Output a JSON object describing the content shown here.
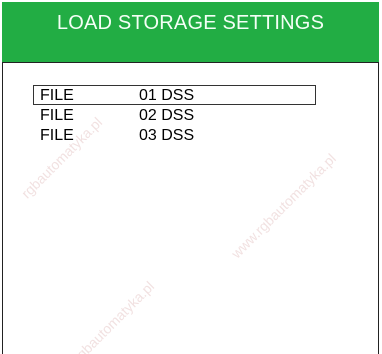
{
  "header": {
    "title": "LOAD STORAGE SETTINGS"
  },
  "files": [
    {
      "label": "FILE",
      "name": "01 DSS",
      "selected": true
    },
    {
      "label": "FILE",
      "name": "02 DSS",
      "selected": false
    },
    {
      "label": "FILE",
      "name": "03 DSS",
      "selected": false
    }
  ],
  "watermark": {
    "text_a": "www.rgbautomatyka.pl",
    "text_b": "rgbautomatyka.pl"
  },
  "colors": {
    "header_bg": "#22ad44",
    "header_text": "#f4fff6",
    "selection_border": "#333333"
  }
}
